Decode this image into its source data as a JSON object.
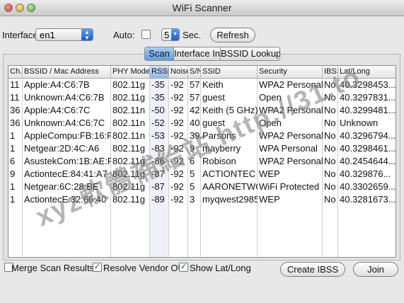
{
  "window": {
    "title": "WiFi Scanner"
  },
  "controls": {
    "interface_label": "Interface",
    "interface_value": "en1",
    "auto_label": "Auto:",
    "auto_checked": false,
    "interval_value": "5",
    "sec_label": "Sec.",
    "refresh_label": "Refresh"
  },
  "tabs": [
    {
      "label": "Scan",
      "selected": true
    },
    {
      "label": "Interface Info",
      "selected": false
    },
    {
      "label": "BSSID Lookup",
      "selected": false
    }
  ],
  "table": {
    "columns": [
      "Ch.",
      "BSSID / Mac Address",
      "PHY Mode",
      "RSSI",
      "Noise",
      "S/N",
      "SSID",
      "Security",
      "IBSS",
      "Lat/Long"
    ],
    "sorted_column": "RSSI",
    "rows": [
      [
        "11",
        "Apple:A4:C6:7B",
        "802.11g",
        "-35",
        "-92",
        "57",
        "Keith",
        "WPA2 Personal",
        "No",
        "40.3298453..."
      ],
      [
        "11",
        "Unknown:A4:C6:7B",
        "802.11g",
        "-35",
        "-92",
        "57",
        "guest",
        "Open",
        "No",
        "40.3297831..."
      ],
      [
        "36",
        "Apple:A4:C6:7C",
        "802.11n",
        "-50",
        "-92",
        "42",
        "Keith (5 GHz)",
        "WPA2 Personal",
        "No",
        "40.3299481..."
      ],
      [
        "36",
        "Unknown:A4:C6:7C",
        "802.11n",
        "-52",
        "-92",
        "40",
        "guest",
        "Open",
        "No",
        "Unknown"
      ],
      [
        "1",
        "AppleCompu:FB:16:F8",
        "802.11n",
        "-53",
        "-92",
        "39",
        "Parsons",
        "WPA2 Personal",
        "No",
        "40.3296794..."
      ],
      [
        "1",
        "Netgear:2D:4C:A6",
        "802.11g",
        "-83",
        "-92",
        "9",
        "mayberry",
        "WPA Personal",
        "No",
        "40.3298461..."
      ],
      [
        "6",
        "AsustekCom:1B:AE:F0",
        "802.11g",
        "-86",
        "-92",
        "6",
        "Robison",
        "WPA2 Personal",
        "No",
        "40.2454644..."
      ],
      [
        "9",
        "ActiontecE:84:41:A7",
        "802.11g",
        "-87",
        "-92",
        "5",
        "ACTIONTEC",
        "WEP",
        "No",
        "40.329876..."
      ],
      [
        "1",
        "Netgear:6C:28:BE",
        "802.11g",
        "-87",
        "-92",
        "5",
        "AARONETWORK",
        "WiFi Protected Setup",
        "No",
        "40.3302659..."
      ],
      [
        "1",
        "ActiontecE:32:66:40",
        "802.11g",
        "-89",
        "-92",
        "3",
        "myqwest2985",
        "WEP",
        "No",
        "40.3281673..."
      ]
    ]
  },
  "footer": {
    "merge_label": "Merge Scan Results",
    "merge_checked": false,
    "resolve_label": "Resolve Vendor OUI",
    "resolve_checked": true,
    "showlatlong_label": "Show Lat/Long",
    "showlatlong_checked": true,
    "create_ibss_label": "Create IBSS",
    "join_label": "Join"
  },
  "watermark": "xyz軟體補給站 http://31.to",
  "colors": {
    "selection_blue": "#5d9be7",
    "popup_blue": "#1a5fd0"
  }
}
